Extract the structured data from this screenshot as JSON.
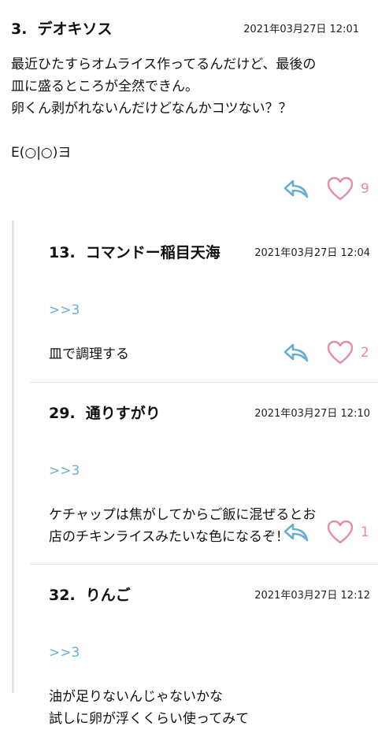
{
  "post": {
    "number": "3.",
    "name": "デオキソス",
    "date": "2021年03月27日 12:01",
    "body": "最近ひたすらオムライス作ってるんだけど、最後の\n皿に盛るところが全然できん。\n卵くん剥がれないんだけどなんかコツない？？\n\nE(○|○)ヨ",
    "likes": "9"
  },
  "replies": [
    {
      "number": "13.",
      "name": "コマンドー稲目天海",
      "date": "2021年03月27日 12:04",
      "anchor": ">>3",
      "body": "皿で調理する",
      "likes": "2"
    },
    {
      "number": "29.",
      "name": "通りすがり",
      "date": "2021年03月27日 12:10",
      "anchor": ">>3",
      "body": "ケチャップは焦がしてからご飯に混ぜるとお\n店のチキンライスみたいな色になるぞ！",
      "likes": "1"
    },
    {
      "number": "32.",
      "name": "りんご",
      "date": "2021年03月27日 12:12",
      "anchor": ">>3",
      "body": "油が足りないんじゃないかな\n試しに卵が浮くくらい使ってみて"
    }
  ],
  "colors": {
    "accent_blue": "#6aaed8",
    "like_pink": "#e58aa8"
  },
  "icons": {
    "reply": "reply-arrow-icon",
    "like": "heart-outline-icon"
  }
}
